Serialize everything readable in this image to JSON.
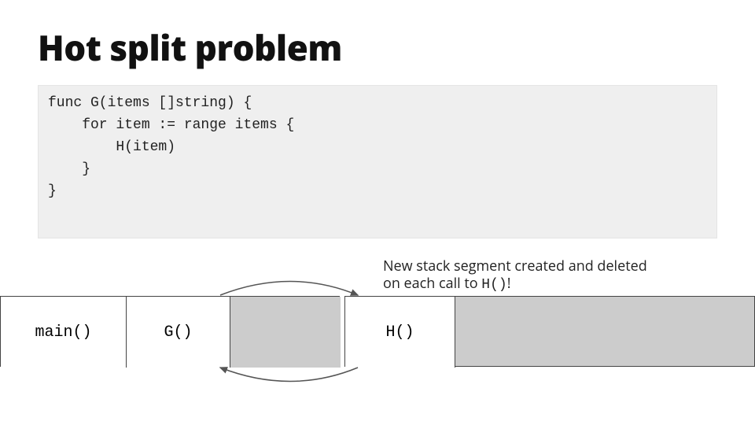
{
  "title": "Hot split problem",
  "code": "func G(items []string) {\n    for item := range items {\n        H(item)\n    }\n}",
  "annotation": {
    "line1": "New stack segment created and deleted",
    "line2_prefix": "on each call to ",
    "line2_code": "H()",
    "line2_suffix": "!"
  },
  "stack": {
    "main": "main()",
    "g": "G()",
    "h": "H()"
  }
}
